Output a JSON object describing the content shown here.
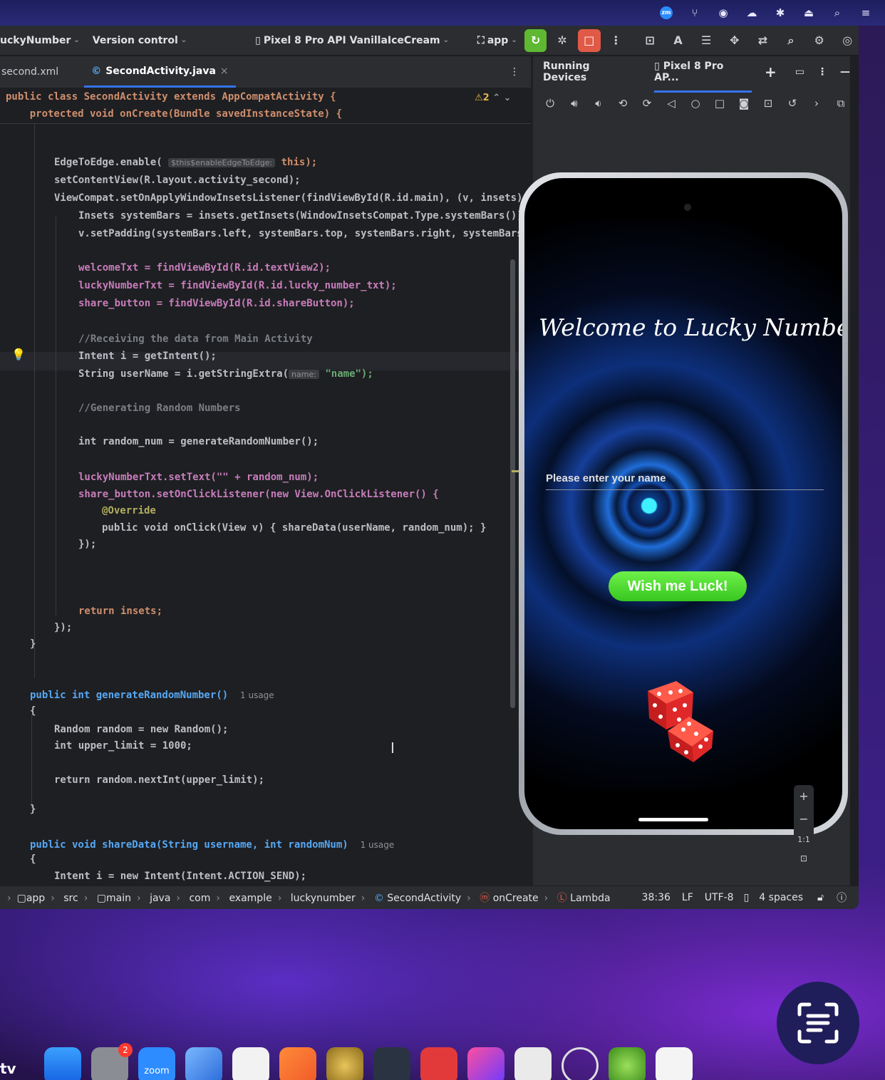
{
  "menubar": {
    "icons": [
      "zoom-icon",
      "fork-icon",
      "record-icon",
      "cloud-icon",
      "bluetooth-off-icon",
      "eject-icon",
      "search-icon",
      "control-center-icon"
    ],
    "zoom_label": "zm"
  },
  "toolbar": {
    "project": "uckyNumber",
    "vcs": "Version control",
    "device": "Pixel 8 Pro API VanillaIceCream",
    "run_config": "app"
  },
  "tabs": [
    {
      "label": "second.xml"
    },
    {
      "label": "SecondActivity.java",
      "active": true
    }
  ],
  "editor": {
    "warning_count": "2",
    "lines": [
      "public class SecondActivity extends AppCompatActivity {",
      "    protected void onCreate(Bundle savedInstanceState) {",
      "EdgeToEdge.enable(",
      "$this$enableEdgeToEdge:",
      "this);",
      "setContentView(R.layout.activity_second);",
      "ViewCompat.setOnApplyWindowInsetsListener(findViewById(R.id.main), (v, insets)",
      "Insets systemBars = insets.getInsets(WindowInsetsCompat.Type.systemBars())",
      "v.setPadding(systemBars.left, systemBars.top, systemBars.right, systemBars",
      "welcomeTxt = findViewById(R.id.textView2);",
      "luckyNumberTxt = findViewById(R.id.lucky_number_txt);",
      "share_button = findViewById(R.id.shareButton);",
      "//Receiving the data from Main Activity",
      "Intent i = getIntent();",
      "String userName = i.getStringExtra(",
      "name:",
      "\"name\");",
      "//Generating Random Numbers",
      "int random_num = generateRandomNumber();",
      "luckyNumberTxt.setText(\"\" + random_num);",
      "share_button.setOnClickListener(new View.OnClickListener() {",
      "@Override",
      "public void onClick(View v) { shareData(userName, random_num); }",
      "});",
      "return insets;",
      "});",
      "}",
      "public int generateRandomNumber()",
      "1 usage",
      "{",
      "Random random = new Random();",
      "int upper_limit = 1000;",
      "return random.nextInt(upper_limit);",
      "}",
      "public void shareData(String username, int randomNum)",
      "1 usage",
      "{",
      "Intent i = new Intent(Intent.ACTION_SEND);"
    ]
  },
  "running_devices": {
    "title": "Running Devices",
    "device_tab": "Pixel 8 Pro AP..."
  },
  "app_screen": {
    "welcome": "Welcome to Lucky Number!",
    "input_placeholder": "Please enter your name",
    "button": "Wish me Luck!"
  },
  "zoom_controls": {
    "plus": "+",
    "minus": "−",
    "one_to_one": "1:1"
  },
  "breadcrumb": [
    "app",
    "src",
    "main",
    "java",
    "com",
    "example",
    "luckynumber",
    "SecondActivity",
    "onCreate",
    "Lambda"
  ],
  "status": {
    "position": "38:36",
    "line_sep": "LF",
    "encoding": "UTF-8",
    "indent": "4 spaces"
  },
  "dock": {
    "left_label": "tv",
    "zoom_label": "zoom",
    "badge": "2"
  },
  "colors": {
    "accent": "#3574f0",
    "run": "#5fb832",
    "stop": "#e05a47",
    "button_green": "#4cd42e"
  }
}
